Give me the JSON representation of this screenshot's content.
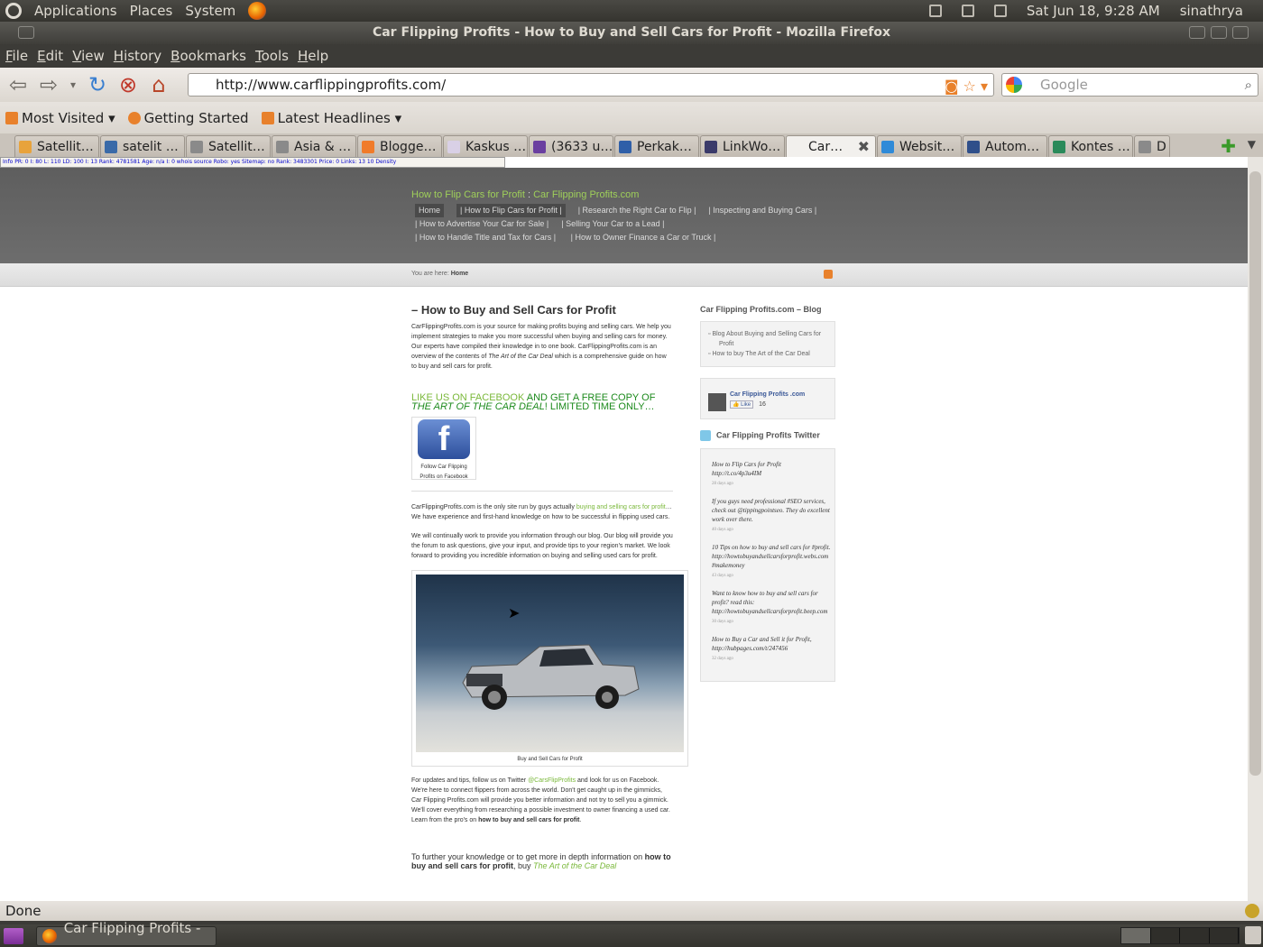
{
  "panel": {
    "menus": [
      "Applications",
      "Places",
      "System"
    ],
    "datetime": "Sat Jun 18,  9:28 AM",
    "user": "sinathrya"
  },
  "window": {
    "title": "Car Flipping Profits - How to Buy and Sell Cars for Profit - Mozilla Firefox"
  },
  "menubar": [
    "File",
    "Edit",
    "View",
    "History",
    "Bookmarks",
    "Tools",
    "Help"
  ],
  "nav": {
    "url": "http://www.carflippingprofits.com/",
    "search_placeholder": "Google"
  },
  "bookmarks": [
    "Most Visited",
    "Getting Started",
    "Latest Headlines"
  ],
  "tabs": [
    {
      "label": "Satellit…",
      "color": "#e8a33c"
    },
    {
      "label": "satelit …",
      "color": "#3a6aa8"
    },
    {
      "label": "Satellit…",
      "color": "#9a9a9a"
    },
    {
      "label": "Asia & …",
      "color": "#9a9a9a"
    },
    {
      "label": "Blogge…",
      "color": "#f07b2a"
    },
    {
      "label": "Kaskus …",
      "color": "#d9d0e6"
    },
    {
      "label": "(3633 u…",
      "color": "#6a3fa0"
    },
    {
      "label": "Perkak…",
      "color": "#2f5fa8"
    },
    {
      "label": "LinkWo…",
      "color": "#3a3a6a"
    },
    {
      "label": "Car…",
      "color": "#f2f0ed"
    },
    {
      "label": "Websit…",
      "color": "#2f8ad8"
    },
    {
      "label": "Autom…",
      "color": "#2f4f8a"
    },
    {
      "label": "Kontes …",
      "color": "#2a8a5a"
    },
    {
      "label": "D",
      "color": "#9a9a9a"
    }
  ],
  "addon_strip": "Info  PR: 0  I: 80  L: 110  LD: 100  I: 13  Rank: 4781581  Age: n/a  I: 0  whois  source  Robo: yes  Sitemap: no  Rank: 3483301  Price: 0  Links: 13 10  Density",
  "site": {
    "title": "How to Flip Cars for Profit",
    "title_sep": " : ",
    "title_link": "Car Flipping Profits.com",
    "nav": [
      "Home",
      "| How to Flip Cars for Profit |",
      "| Research the Right Car to Flip |",
      "| Inspecting and Buying Cars |",
      "| How to Advertise Your Car for Sale |",
      "| Selling Your Car to a Lead |",
      "| How to Handle Title and Tax for Cars |",
      "| How to Owner Finance a Car or Truck |"
    ],
    "crumb_label": "You are here:",
    "crumb_page": "Home"
  },
  "article": {
    "heading": "– How to Buy and Sell Cars for Profit",
    "intro_a": "CarFlippingProfits.com is your source for making profits buying and selling cars. We help you implement strategies to make you more successful when buying and selling cars for money. Our experts have compiled their knowledge in to one book. CarFlippingProfits.com is an overview of the contents of ",
    "intro_italic": "The Art of the Car Deal",
    "intro_b": " which is a comprehensive guide on how to buy and sell cars for profit.",
    "promo_green": "LIKE US ON FACEBOOK",
    "promo_a": " AND GET A FREE COPY OF ",
    "promo_italic": "THE ART OF THE CAR DEAL",
    "promo_b": "! LIMITED TIME ONLY…",
    "fb_caption": "Follow Car Flipping Profits on Facebook",
    "p2_a": "CarFlippingProfits.com is the only site run by guys actually ",
    "p2_link": "buying and selling cars for profit",
    "p2_b": "… We have experience and first-hand knowledge on how to be successful in flipping used cars.",
    "p3": "We will continually work to provide you information through our blog. Our blog will provide you the forum to ask questions, give your input, and provide tips to your region's market. We look forward to providing you incredible information on buying and selling used cars for profit.",
    "image_caption": "Buy and Sell Cars for Profit",
    "p4_a": "For updates and tips, follow us on Twitter ",
    "p4_link": "@CarsFlipProfits",
    "p4_b": " and look for us on Facebook. We're here to connect flippers from across the world. Don't get caught up in the gimmicks, Car Flipping Profits.com will provide you better information and not try to sell you a gimmick. We'll cover everything from researching a possible investment to owner financing a used car. Learn from the pro's on ",
    "p4_bold": "how to buy and sell cars for profit",
    "p4_c": ".",
    "p5_a": "To further your knowledge or to get more in depth information on ",
    "p5_bold": "how to buy and sell cars for profit",
    "p5_c": ", buy ",
    "p5_link": "The Art of the Car Deal"
  },
  "sidebar": {
    "blog_title": "Car Flipping Profits.com – Blog",
    "blog_items": [
      "Blog About Buying and Selling Cars for Profit",
      "How to buy The Art of the Car Deal"
    ],
    "fb_page": "Car Flipping Profits .com",
    "fb_like": "Like",
    "fb_count": "16",
    "twitter_title": "Car Flipping Profits Twitter",
    "tweets": [
      {
        "text": "How to Flip Cars for Profit http://t.co/4p3u4IM",
        "age": "28 days ago"
      },
      {
        "text": "If you guys need professional #SEO services, check out @tippingpointseo. They do excellent work over there.",
        "age": "40 days ago"
      },
      {
        "text": "10 Tips on how to buy and sell cars for #profit. http://howtobuyandsellcarsforprofit.webs.com #makemoney",
        "age": "43 days ago"
      },
      {
        "text": "Want to know how to buy and sell cars for profit? read this: http://howtobuyandsellcarsforprofit.beep.com",
        "age": "30 days ago"
      },
      {
        "text": "How to Buy a Car and Sell it for Profit, http://hubpages.com/t/247456",
        "age": "32 days ago"
      }
    ]
  },
  "status": "Done",
  "taskbar": {
    "task": "Car Flipping Profits - …"
  }
}
